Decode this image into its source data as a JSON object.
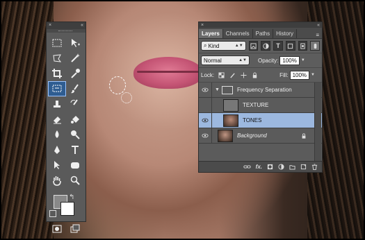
{
  "tools_panel": {
    "close": "×",
    "collapse": "«"
  },
  "layers_panel": {
    "close": "×",
    "collapse": "«",
    "tabs": [
      "Layers",
      "Channels",
      "Paths",
      "History"
    ],
    "filter": {
      "label": "Kind"
    },
    "blend_mode": "Normal",
    "opacity": {
      "label": "Opacity:",
      "value": "100%"
    },
    "lock": {
      "label": "Lock:"
    },
    "fill": {
      "label": "Fill:",
      "value": "100%"
    },
    "layers": [
      {
        "name": "Frequency Separation",
        "type": "group"
      },
      {
        "name": "TEXTURE",
        "type": "layer"
      },
      {
        "name": "TONES",
        "type": "layer",
        "selected": true
      },
      {
        "name": "Background",
        "type": "background",
        "locked": true
      }
    ]
  },
  "colors": {
    "foreground": "#888888",
    "background": "#ffffff",
    "selected_row": "#9cb8df",
    "panel": "#5d5d5d"
  }
}
